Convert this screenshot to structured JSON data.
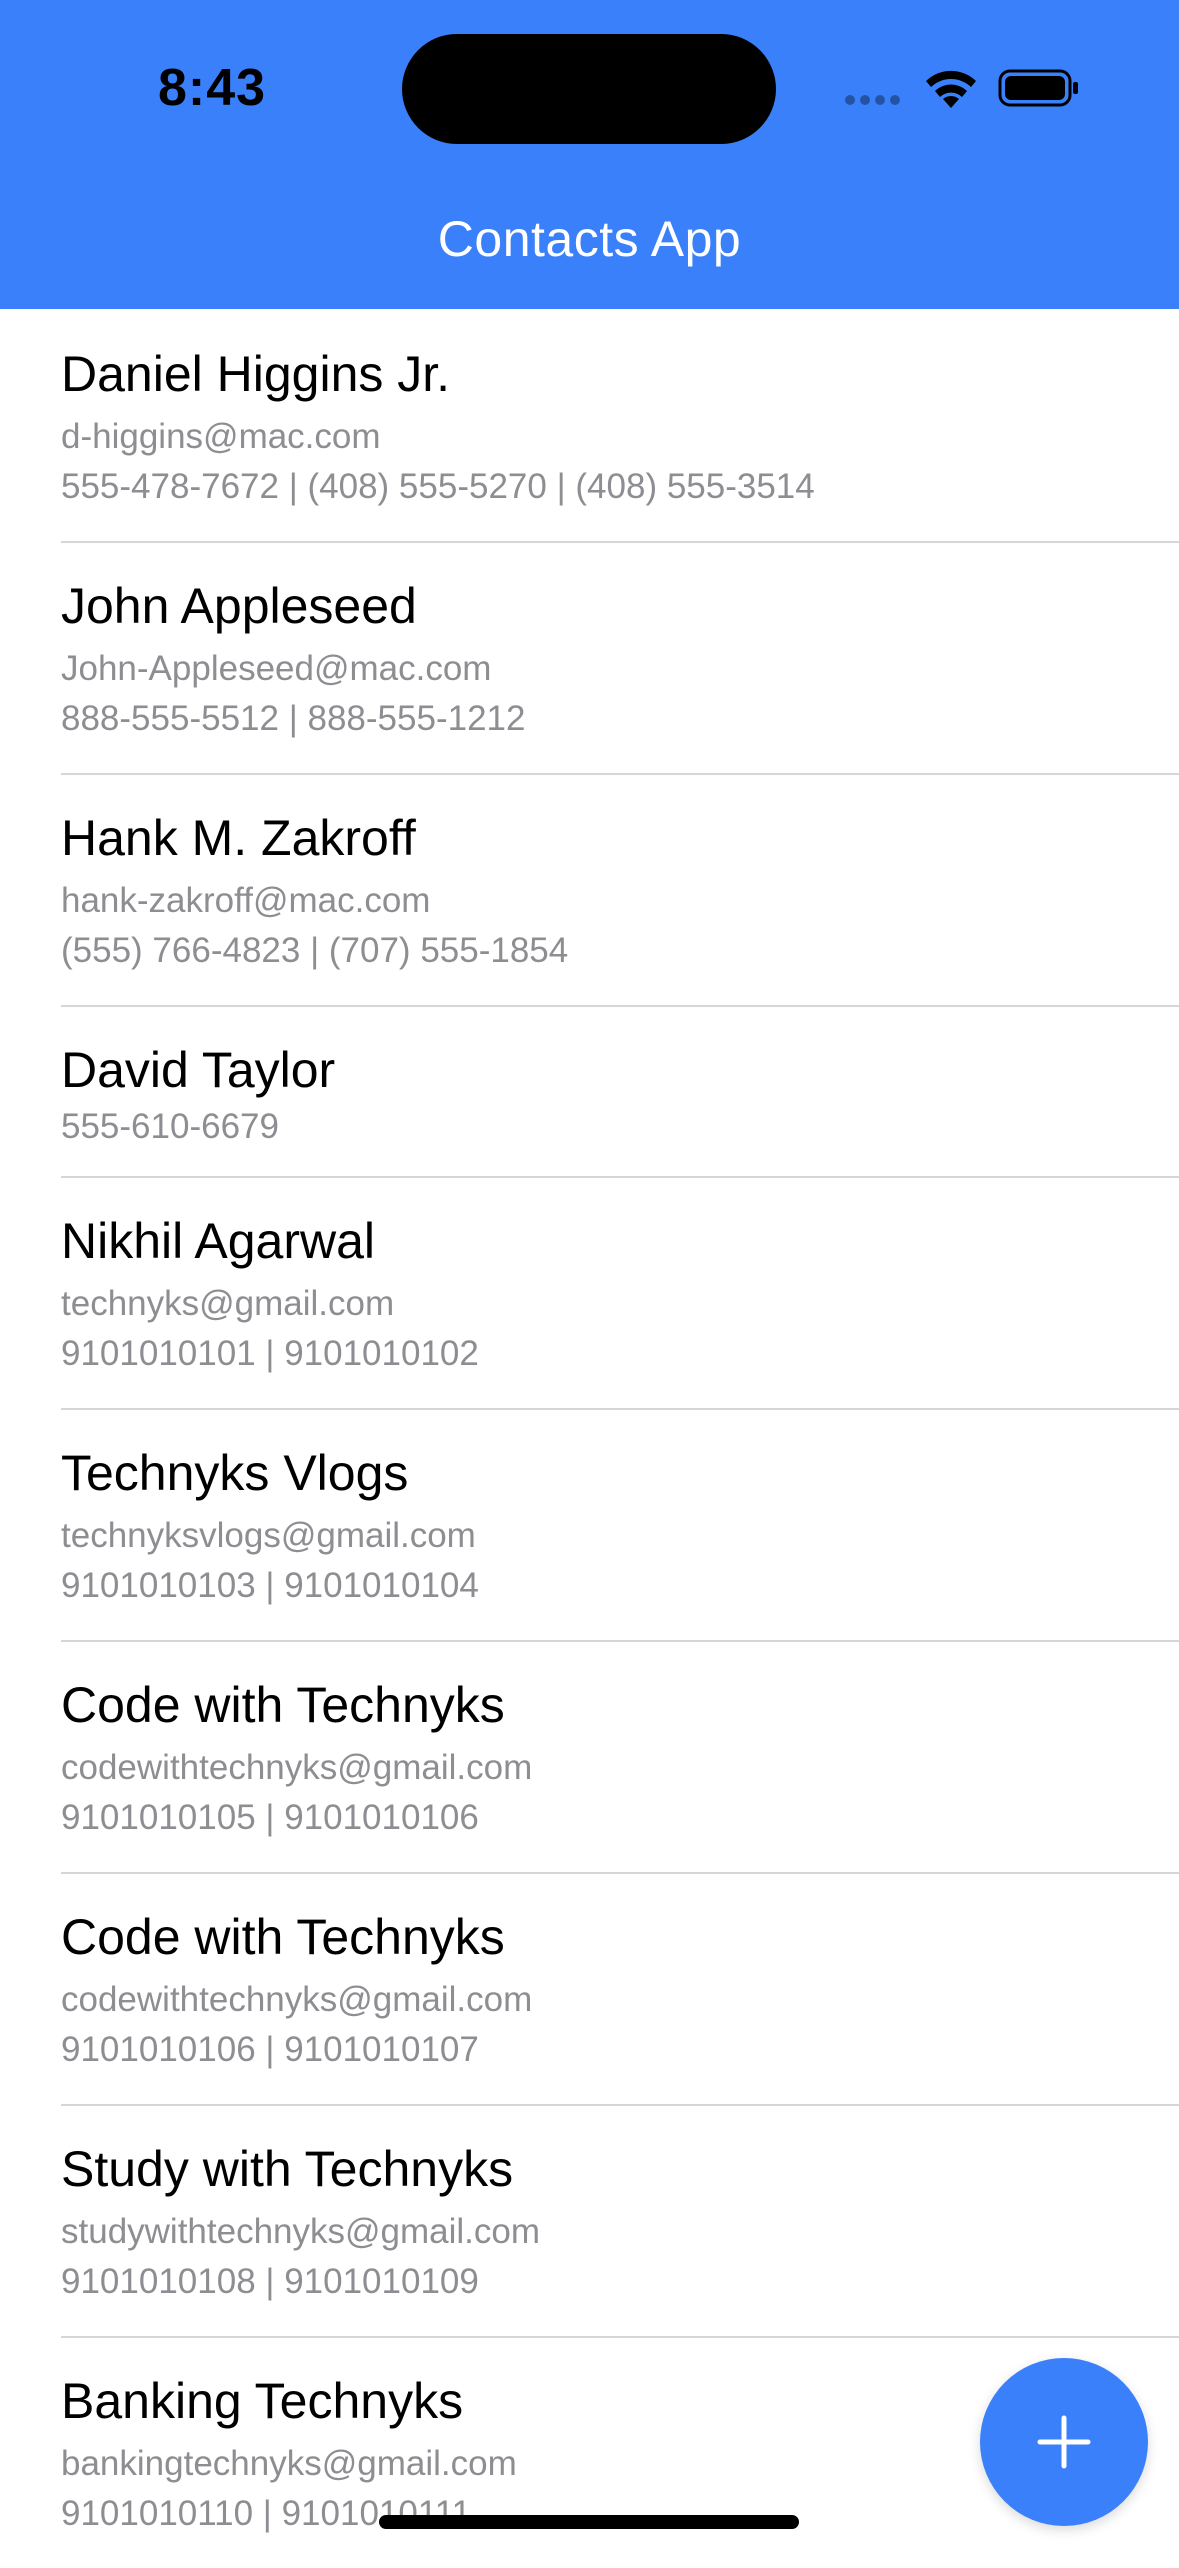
{
  "status_bar": {
    "time": "8:43"
  },
  "header": {
    "title": "Contacts App"
  },
  "contacts": [
    {
      "name": "Daniel Higgins Jr.",
      "email": "d-higgins@mac.com",
      "phones": "555-478-7672 | (408) 555-5270 | (408) 555-3514"
    },
    {
      "name": "John Appleseed",
      "email": "John-Appleseed@mac.com",
      "phones": "888-555-5512 | 888-555-1212"
    },
    {
      "name": "Hank M. Zakroff",
      "email": "hank-zakroff@mac.com",
      "phones": "(555) 766-4823 | (707) 555-1854"
    },
    {
      "name": "David Taylor",
      "email": "",
      "phones": "555-610-6679"
    },
    {
      "name": "Nikhil Agarwal",
      "email": "technyks@gmail.com",
      "phones": "9101010101 | 9101010102"
    },
    {
      "name": "Technyks Vlogs",
      "email": "technyksvlogs@gmail.com",
      "phones": "9101010103 | 9101010104"
    },
    {
      "name": "Code with Technyks",
      "email": "codewithtechnyks@gmail.com",
      "phones": "9101010105 | 9101010106"
    },
    {
      "name": "Code with Technyks",
      "email": "codewithtechnyks@gmail.com",
      "phones": "9101010106 | 9101010107"
    },
    {
      "name": "Study with Technyks",
      "email": "studywithtechnyks@gmail.com",
      "phones": "9101010108 | 9101010109"
    },
    {
      "name": "Banking Technyks",
      "email": "bankingtechnyks@gmail.com",
      "phones": "9101010110 | 9101010111"
    }
  ],
  "fab": {
    "icon": "plus-icon"
  },
  "colors": {
    "accent": "#3a80fb",
    "secondary_text": "#8d8d92",
    "divider": "#d6d6d8"
  }
}
